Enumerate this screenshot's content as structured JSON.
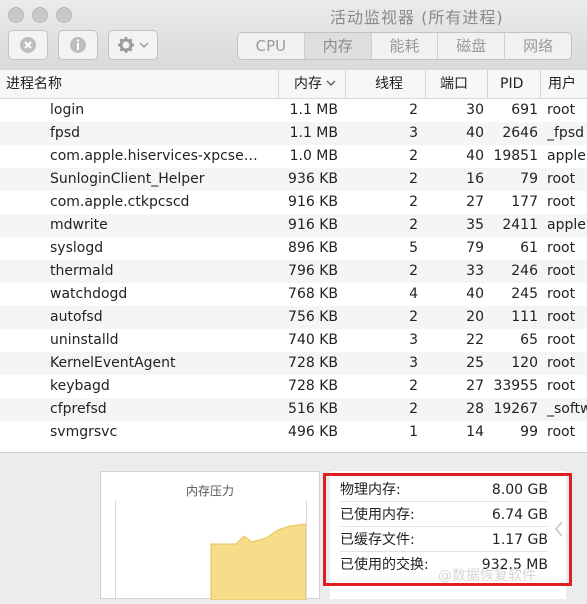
{
  "window": {
    "title": "活动监视器 (所有进程)"
  },
  "toolbar": {
    "close_process_icon": "x-circle-icon",
    "info_icon": "info-icon",
    "gear_icon": "gear-icon",
    "dropdown_icon": "chevron-down-icon"
  },
  "tabs": [
    "CPU",
    "内存",
    "能耗",
    "磁盘",
    "网络"
  ],
  "active_tab": "内存",
  "columns": {
    "name": "进程名称",
    "memory": "内存",
    "threads": "线程",
    "ports": "端口",
    "pid": "PID",
    "user": "用户"
  },
  "processes": [
    {
      "name": "login",
      "memory": "1.1 MB",
      "threads": "2",
      "ports": "30",
      "pid": "691",
      "user": "root"
    },
    {
      "name": "fpsd",
      "memory": "1.1 MB",
      "threads": "3",
      "ports": "40",
      "pid": "2646",
      "user": "_fpsd"
    },
    {
      "name": "com.apple.hiservices-xpcser...",
      "memory": "1.0 MB",
      "threads": "2",
      "ports": "40",
      "pid": "19851",
      "user": "apple"
    },
    {
      "name": "SunloginClient_Helper",
      "memory": "936 KB",
      "threads": "2",
      "ports": "16",
      "pid": "79",
      "user": "root"
    },
    {
      "name": "com.apple.ctkpcscd",
      "memory": "916 KB",
      "threads": "2",
      "ports": "27",
      "pid": "177",
      "user": "root"
    },
    {
      "name": "mdwrite",
      "memory": "916 KB",
      "threads": "2",
      "ports": "35",
      "pid": "2411",
      "user": "apple"
    },
    {
      "name": "syslogd",
      "memory": "896 KB",
      "threads": "5",
      "ports": "79",
      "pid": "61",
      "user": "root"
    },
    {
      "name": "thermald",
      "memory": "796 KB",
      "threads": "2",
      "ports": "33",
      "pid": "246",
      "user": "root"
    },
    {
      "name": "watchdogd",
      "memory": "768 KB",
      "threads": "4",
      "ports": "40",
      "pid": "245",
      "user": "root"
    },
    {
      "name": "autofsd",
      "memory": "756 KB",
      "threads": "2",
      "ports": "20",
      "pid": "111",
      "user": "root"
    },
    {
      "name": "uninstalld",
      "memory": "740 KB",
      "threads": "3",
      "ports": "22",
      "pid": "65",
      "user": "root"
    },
    {
      "name": "KernelEventAgent",
      "memory": "728 KB",
      "threads": "3",
      "ports": "25",
      "pid": "120",
      "user": "root"
    },
    {
      "name": "keybagd",
      "memory": "728 KB",
      "threads": "2",
      "ports": "27",
      "pid": "33955",
      "user": "root"
    },
    {
      "name": "cfprefsd",
      "memory": "516 KB",
      "threads": "2",
      "ports": "28",
      "pid": "19267",
      "user": "_softw"
    },
    {
      "name": "svmgrsvc",
      "memory": "496 KB",
      "threads": "1",
      "ports": "14",
      "pid": "99",
      "user": "root"
    }
  ],
  "memory_pressure": {
    "title": "内存压力"
  },
  "stats": [
    {
      "label": "物理内存:",
      "value": "8.00 GB"
    },
    {
      "label": "已使用内存:",
      "value": "6.74 GB"
    },
    {
      "label": "已缓存文件:",
      "value": "1.17 GB"
    },
    {
      "label": "已使用的交换:",
      "value": "932.5 MB"
    }
  ],
  "watermark": "@数据恢复软件",
  "colors": {
    "highlight_box": "#e02020",
    "pressure_fill": "#f7dc8a"
  }
}
